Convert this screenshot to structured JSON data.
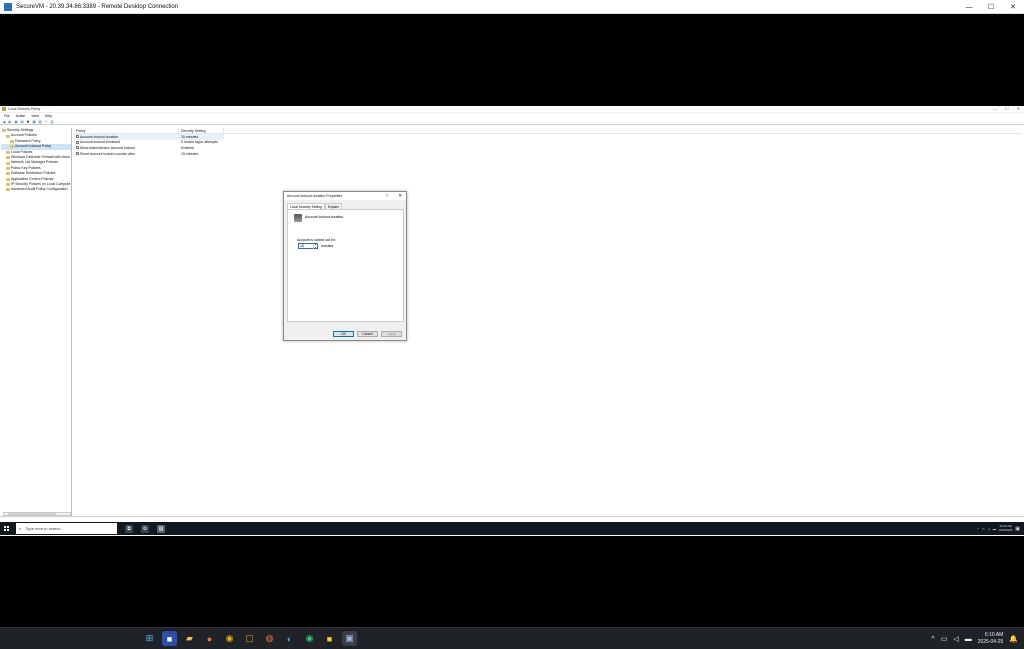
{
  "rdp": {
    "title": "SecureVM - 20.39.34.86:3389 - Remote Desktop Connection",
    "minimize": "—",
    "maximize": "☐",
    "close": "✕"
  },
  "mmc": {
    "title": "Local Security Policy",
    "menu": [
      "File",
      "Action",
      "View",
      "Help"
    ],
    "tree": [
      {
        "label": "Security Settings",
        "indent": 0
      },
      {
        "label": "Account Policies",
        "indent": 1
      },
      {
        "label": "Password Policy",
        "indent": 2
      },
      {
        "label": "Account Lockout Policy",
        "indent": 2,
        "selected": true
      },
      {
        "label": "Local Policies",
        "indent": 1
      },
      {
        "label": "Windows Defender Firewall with Adva",
        "indent": 1
      },
      {
        "label": "Network List Manager Policies",
        "indent": 1
      },
      {
        "label": "Public Key Policies",
        "indent": 1
      },
      {
        "label": "Software Restriction Policies",
        "indent": 1
      },
      {
        "label": "Application Control Policies",
        "indent": 1
      },
      {
        "label": "IP Security Policies on Local Compute",
        "indent": 1
      },
      {
        "label": "Advanced Audit Policy Configuration",
        "indent": 1
      }
    ],
    "list": {
      "col_policy": "Policy",
      "col_setting": "Security Setting",
      "rows": [
        {
          "policy": "Account lockout duration",
          "setting": "15 minutes",
          "selected": true
        },
        {
          "policy": "Account lockout threshold",
          "setting": "5 invalid logon attempts"
        },
        {
          "policy": "Allow Administrator account lockout",
          "setting": "Enabled"
        },
        {
          "policy": "Reset account lockout counter after",
          "setting": "15 minutes"
        }
      ]
    }
  },
  "dialog": {
    "title": "Account lockout duration Properties",
    "help": "?",
    "close": "✕",
    "tab_local": "Local Security Setting",
    "tab_explain": "Explain",
    "policy_name": "Account lockout duration",
    "label": "Account is locked out for:",
    "value": "15",
    "unit": "minutes",
    "ok": "OK",
    "cancel": "Cancel",
    "apply": "Apply"
  },
  "vm_taskbar": {
    "search_placeholder": "Type here to search",
    "time": "10:10 AM",
    "date": "4/25/2025"
  },
  "host_taskbar": {
    "time": "6:10 AM",
    "date": "2025-04-25"
  }
}
